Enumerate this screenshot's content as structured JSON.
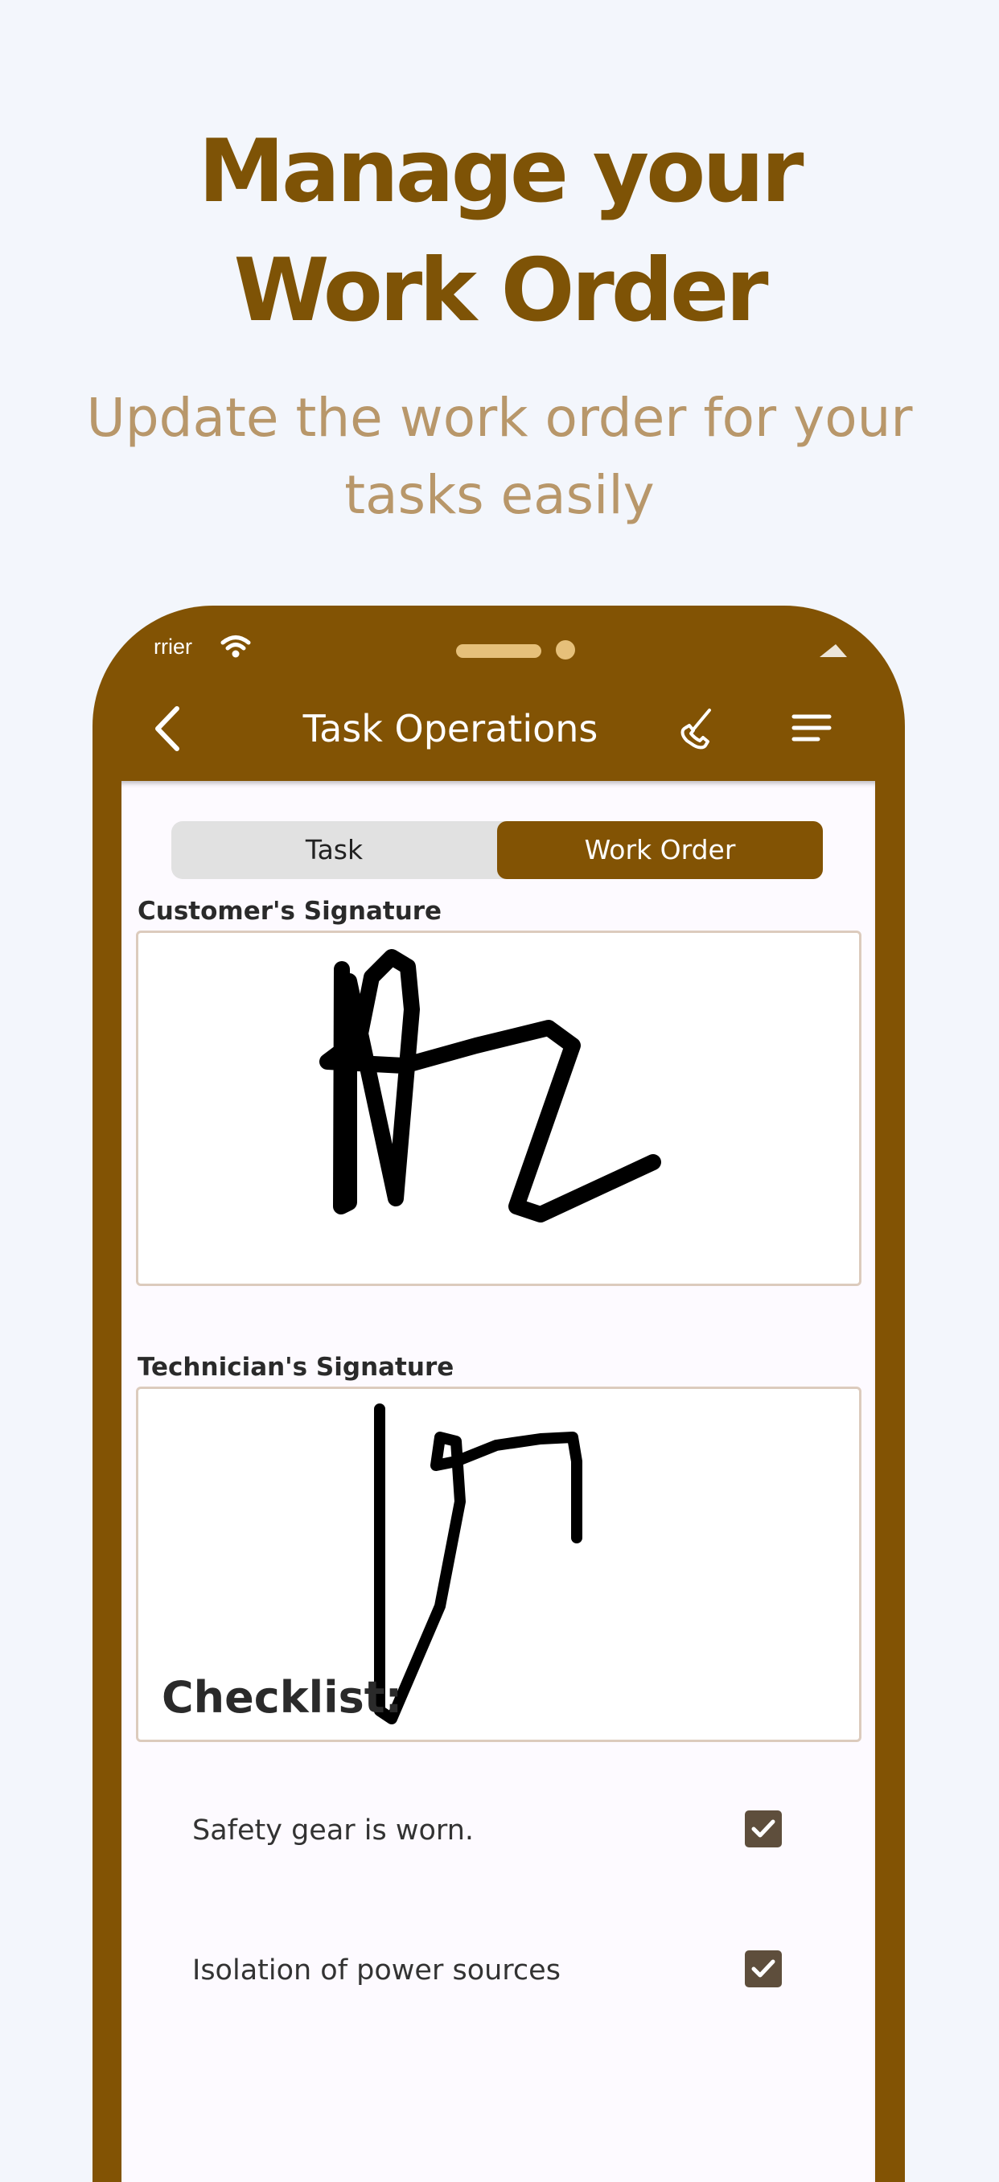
{
  "marketing": {
    "headline_line1": "Manage your",
    "headline_line2": "Work Order",
    "subheadline": "Update the work order for your tasks easily"
  },
  "status_bar": {
    "carrier": "rrier"
  },
  "nav": {
    "title": "Task Operations"
  },
  "tabs": {
    "task_label": "Task",
    "work_order_label": "Work Order",
    "selected": "Work Order"
  },
  "signatures": {
    "customer_label": "Customer's Signature",
    "technician_label": "Technician's Signature"
  },
  "checklist": {
    "title": "Checklist:",
    "items": [
      {
        "label": "Safety gear is worn.",
        "checked": true
      },
      {
        "label": "Isolation of power sources",
        "checked": true
      }
    ]
  },
  "colors": {
    "brand": "#825304",
    "headline": "#7e5306",
    "subheadline": "#b8976a",
    "background": "#f3f6fc",
    "checkbox": "#5e4e3c"
  },
  "icons": [
    "back-chevron-icon",
    "phone-icon",
    "menu-icon",
    "wifi-icon",
    "battery-icon",
    "checkmark-icon"
  ]
}
